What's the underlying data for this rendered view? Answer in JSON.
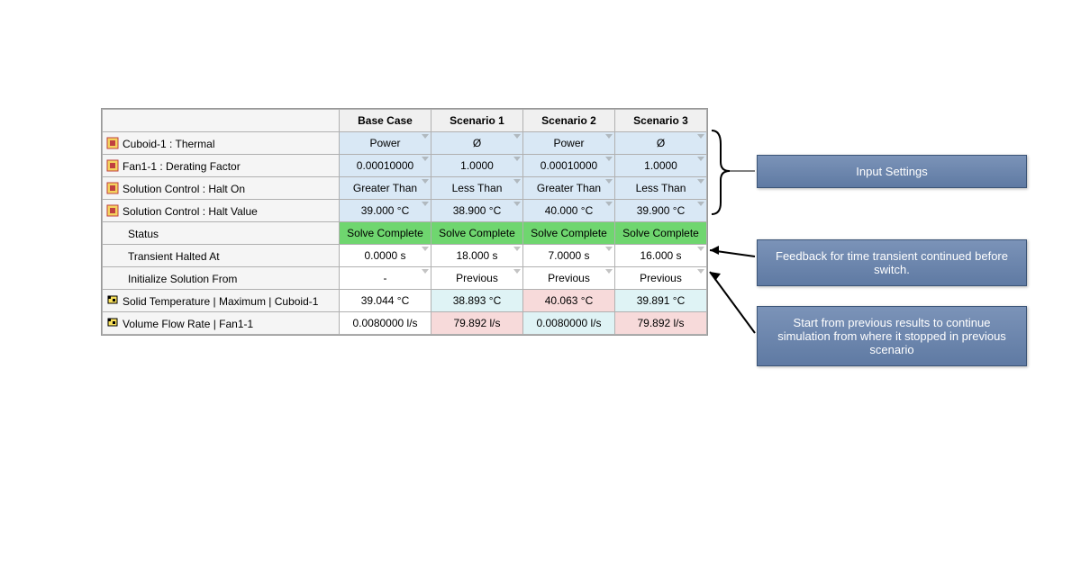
{
  "columns": [
    "Base Case",
    "Scenario 1",
    "Scenario 2",
    "Scenario 3"
  ],
  "rows": {
    "cuboid_thermal": {
      "label": "Cuboid-1 : Thermal",
      "base": "Power",
      "s1": "Ø",
      "s2": "Power",
      "s3": "Ø"
    },
    "fan_derating": {
      "label": "Fan1-1 : Derating Factor",
      "base": "0.00010000",
      "s1": "1.0000",
      "s2": "0.00010000",
      "s3": "1.0000"
    },
    "halt_on": {
      "label": "Solution Control : Halt On",
      "base": "Greater Than",
      "s1": "Less Than",
      "s2": "Greater Than",
      "s3": "Less Than"
    },
    "halt_value": {
      "label": "Solution Control : Halt Value",
      "base": "39.000 °C",
      "s1": "38.900 °C",
      "s2": "40.000 °C",
      "s3": "39.900 °C"
    },
    "status": {
      "label": "Status",
      "base": "Solve Complete",
      "s1": "Solve Complete",
      "s2": "Solve Complete",
      "s3": "Solve Complete"
    },
    "halted_at": {
      "label": "Transient Halted At",
      "base": "0.0000 s",
      "s1": "18.000 s",
      "s2": "7.0000 s",
      "s3": "16.000 s"
    },
    "init_from": {
      "label": "Initialize Solution From",
      "base": "-",
      "s1": "Previous",
      "s2": "Previous",
      "s3": "Previous"
    },
    "solid_temp": {
      "label": "Solid Temperature | Maximum | Cuboid-1",
      "base": "39.044 °C",
      "s1": "38.893 °C",
      "s2": "40.063 °C",
      "s3": "39.891 °C"
    },
    "vfr": {
      "label": "Volume Flow Rate | Fan1-1",
      "base": "0.0080000 l/s",
      "s1": "79.892 l/s",
      "s2": "0.0080000 l/s",
      "s3": "79.892 l/s"
    }
  },
  "callouts": {
    "input_settings": "Input Settings",
    "feedback": "Feedback for time transient continued before switch.",
    "start_prev": "Start from previous results to continue simulation from where it stopped in previous scenario"
  }
}
